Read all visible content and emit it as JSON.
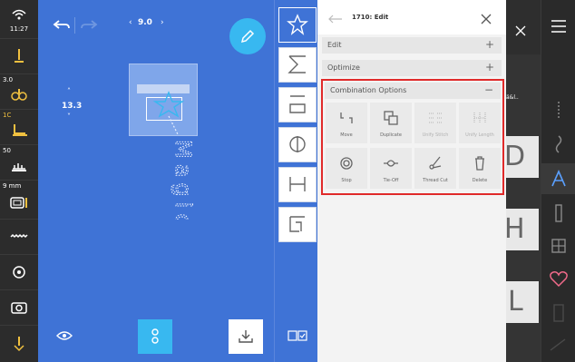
{
  "status": {
    "time": "11:27"
  },
  "left_sidebar": {
    "tension_value": "3.0",
    "presser_value": "1C",
    "speed_value": "50",
    "width_value": "9 mm"
  },
  "canvas": {
    "zoom_value": "9.0",
    "position_value": "13.3",
    "pattern_text": "Magic"
  },
  "panel": {
    "title": "1710: Edit",
    "sections": {
      "edit": {
        "label": "Edit",
        "sign": "+"
      },
      "optimize": {
        "label": "Optimize",
        "sign": "+"
      },
      "combination": {
        "label": "Combination Options",
        "sign": "−"
      }
    },
    "tools": [
      {
        "label": "Move",
        "icon": "move-icon",
        "enabled": true
      },
      {
        "label": "Duplicate",
        "icon": "duplicate-icon",
        "enabled": true
      },
      {
        "label": "Unify Stitch",
        "icon": "unify-stitch-icon",
        "enabled": false
      },
      {
        "label": "Unify Length",
        "icon": "unify-length-icon",
        "enabled": false
      },
      {
        "label": "Stop",
        "icon": "stop-icon",
        "enabled": true
      },
      {
        "label": "Tie-Off",
        "icon": "tie-off-icon",
        "enabled": true
      },
      {
        "label": "Thread Cut",
        "icon": "thread-cut-icon",
        "enabled": true
      },
      {
        "label": "Delete",
        "icon": "delete-icon",
        "enabled": true
      }
    ]
  },
  "gallery": {
    "header_text": "ä&l..",
    "letters": [
      "D",
      "H",
      "L"
    ]
  },
  "colors": {
    "canvas_blue": "#3f73d6",
    "accent_cyan": "#38b8f0",
    "highlight_red": "#e02a2a",
    "sidebar_dark": "#2c2c2c",
    "icon_yellow": "#f0c040",
    "favorite_pink": "#f06a8a"
  }
}
